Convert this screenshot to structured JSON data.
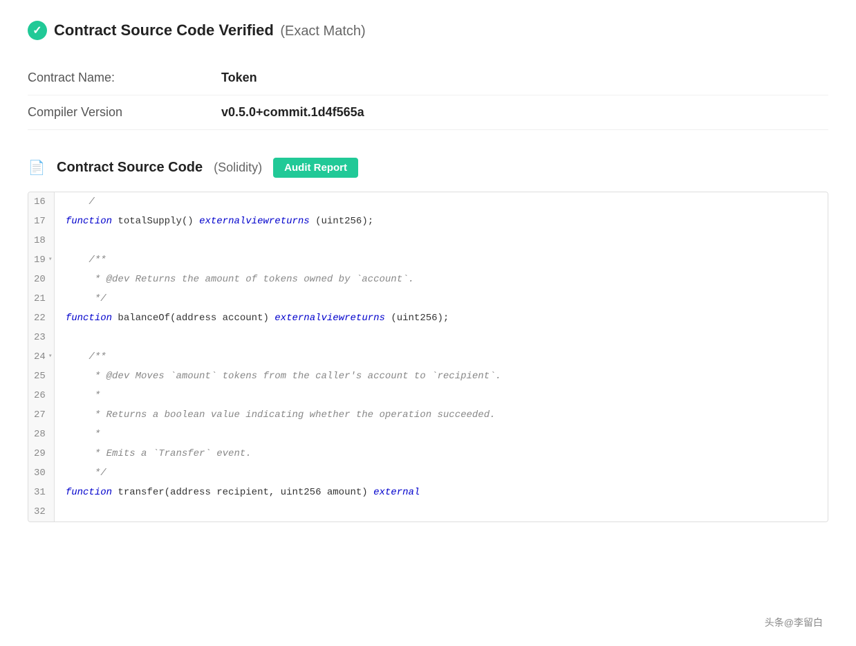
{
  "verified": {
    "icon_label": "verified-checkmark",
    "title": "Contract Source Code Verified",
    "subtitle": "(Exact Match)"
  },
  "contract_info": {
    "rows": [
      {
        "label": "Contract Name:",
        "value": "Token"
      },
      {
        "label": "Compiler Version",
        "value": "v0.5.0+commit.1d4f565a"
      }
    ]
  },
  "source_code_section": {
    "icon": "📄",
    "title": "Contract Source Code",
    "subtitle": "(Solidity)",
    "audit_button_label": "Audit Report"
  },
  "code_lines": [
    {
      "num": "16",
      "has_arrow": false,
      "content": "    /"
    },
    {
      "num": "17",
      "has_arrow": false,
      "content": "    function totalSupply() external view returns (uint256);"
    },
    {
      "num": "18",
      "has_arrow": false,
      "content": ""
    },
    {
      "num": "19",
      "has_arrow": true,
      "content": "    /**"
    },
    {
      "num": "20",
      "has_arrow": false,
      "content": "     * @dev Returns the amount of tokens owned by `account`."
    },
    {
      "num": "21",
      "has_arrow": false,
      "content": "     */"
    },
    {
      "num": "22",
      "has_arrow": false,
      "content": "    function balanceOf(address account) external view returns (uint256);"
    },
    {
      "num": "23",
      "has_arrow": false,
      "content": ""
    },
    {
      "num": "24",
      "has_arrow": true,
      "content": "    /**"
    },
    {
      "num": "25",
      "has_arrow": false,
      "content": "     * @dev Moves `amount` tokens from the caller's account to `recipient`."
    },
    {
      "num": "26",
      "has_arrow": false,
      "content": "     *"
    },
    {
      "num": "27",
      "has_arrow": false,
      "content": "     * Returns a boolean value indicating whether the operation succeeded."
    },
    {
      "num": "28",
      "has_arrow": false,
      "content": "     *"
    },
    {
      "num": "29",
      "has_arrow": false,
      "content": "     * Emits a `Transfer` event."
    },
    {
      "num": "30",
      "has_arrow": false,
      "content": "     */"
    },
    {
      "num": "31",
      "has_arrow": false,
      "content": "    function transfer(address recipient, uint256 amount) external"
    },
    {
      "num": "32",
      "has_arrow": false,
      "content": ""
    }
  ],
  "watermark": {
    "text": "头条@李留白"
  },
  "colors": {
    "verified_green": "#21c997",
    "audit_btn_bg": "#21c997"
  }
}
